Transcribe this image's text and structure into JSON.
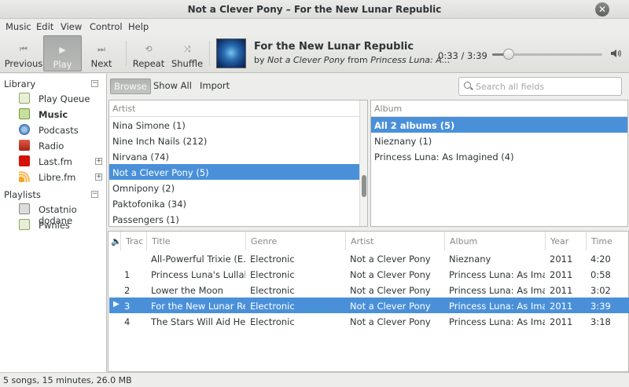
{
  "window": {
    "title": "Not a Clever Pony – For the New Lunar Republic"
  },
  "menubar": {
    "items": [
      "Music",
      "Edit",
      "View",
      "Control",
      "Help"
    ]
  },
  "toolbar": {
    "previous_label": "Previous",
    "play_label": "Play",
    "next_label": "Next",
    "repeat_label": "Repeat",
    "shuffle_label": "Shuffle"
  },
  "now_playing": {
    "title": "For the New Lunar Republic",
    "by_prefix": "by",
    "artist": "Not a Clever Pony",
    "from_prefix": "from",
    "album": "Princess Luna: A...",
    "time": "0:33 / 3:39",
    "progress_fraction": 0.151
  },
  "sidebar": {
    "library_heading": "Library",
    "library_items": [
      {
        "label": "Play Queue",
        "icon": "play-queue-icon"
      },
      {
        "label": "Music",
        "icon": "music-note-icon"
      },
      {
        "label": "Podcasts",
        "icon": "podcast-icon"
      },
      {
        "label": "Radio",
        "icon": "radio-icon"
      },
      {
        "label": "Last.fm",
        "icon": "lastfm-icon"
      },
      {
        "label": "Libre.fm",
        "icon": "librefm-icon"
      }
    ],
    "playlists_heading": "Playlists",
    "playlist_items": [
      {
        "label": "Ostatnio dodane",
        "icon": "auto-playlist-icon"
      },
      {
        "label": "Pwnies",
        "icon": "playlist-icon"
      }
    ]
  },
  "browser": {
    "tabs": [
      "Browse",
      "Show All",
      "Import"
    ],
    "search_placeholder": "Search all fields",
    "artist_header": "Artist",
    "artists": [
      "Nina Simone (1)",
      "Nine Inch Nails (212)",
      "Nirvana (74)",
      "Not a Clever Pony (5)",
      "Omnipony (2)",
      "Paktofonika (34)",
      "Passengers (1)"
    ],
    "album_header": "Album",
    "albums": [
      "All 2 albums (5)",
      "Nieznany (1)",
      "Princess Luna: As Imagined (4)"
    ]
  },
  "tracklist": {
    "columns": [
      "Trac",
      "Title",
      "Genre",
      "Artist",
      "Album",
      "Year",
      "Time"
    ],
    "rows": [
      {
        "track": "",
        "title": "All-Powerful Trixie (E...",
        "genre": "Electronic",
        "artist": "Not a Clever Pony",
        "album": "Nieznany",
        "year": "2011",
        "time": "4:20"
      },
      {
        "track": "1",
        "title": "Princess Luna's Lullaby",
        "genre": "Electronic",
        "artist": "Not a Clever Pony",
        "album": "Princess Luna: As Imag...",
        "year": "2011",
        "time": "0:58"
      },
      {
        "track": "2",
        "title": "Lower the Moon",
        "genre": "Electronic",
        "artist": "Not a Clever Pony",
        "album": "Princess Luna: As Imag...",
        "year": "2011",
        "time": "3:02"
      },
      {
        "track": "3",
        "title": "For the New Lunar Re...",
        "genre": "Electronic",
        "artist": "Not a Clever Pony",
        "album": "Princess Luna: As Imag...",
        "year": "2011",
        "time": "3:39"
      },
      {
        "track": "4",
        "title": "The Stars Will Aid Her...",
        "genre": "Electronic",
        "artist": "Not a Clever Pony",
        "album": "Princess Luna: As Imag...",
        "year": "2011",
        "time": "3:18"
      }
    ]
  },
  "status": {
    "text": "5 songs, 15 minutes, 26.0 MB"
  },
  "colors": {
    "selection": "#4a90d9"
  }
}
